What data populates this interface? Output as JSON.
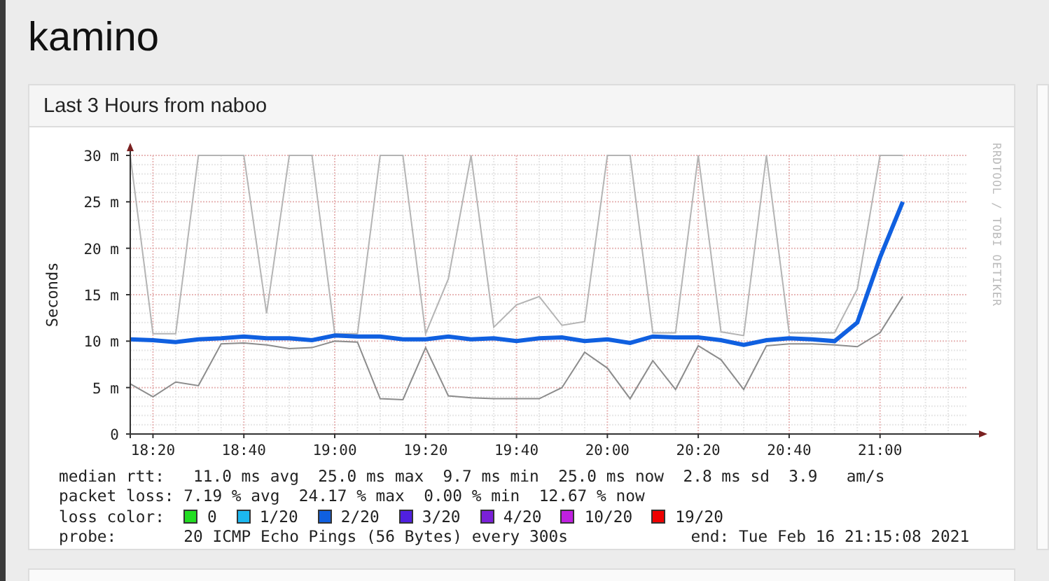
{
  "page_title": "kamino",
  "panel": {
    "title": "Last 3 Hours from naboo",
    "credit": "RRDTOOL / TOBI OETIKER",
    "chart_data": {
      "type": "line",
      "ylabel": "Seconds",
      "categories": [
        null,
        "18:20",
        null,
        null,
        null,
        "18:40",
        null,
        null,
        null,
        "19:00",
        null,
        null,
        null,
        "19:20",
        null,
        null,
        null,
        "19:40",
        null,
        null,
        null,
        "20:00",
        null,
        null,
        null,
        "20:20",
        null,
        null,
        null,
        "20:40",
        null,
        null,
        null,
        "21:00",
        null
      ],
      "ylim": [
        0,
        30
      ],
      "grid": true,
      "yticks": [
        {
          "value": 0,
          "label": "0"
        },
        {
          "value": 5,
          "label": "5 m"
        },
        {
          "value": 10,
          "label": "10 m"
        },
        {
          "value": 15,
          "label": "15 m"
        },
        {
          "value": 20,
          "label": "20 m"
        },
        {
          "value": 25,
          "label": "25 m"
        },
        {
          "value": 30,
          "label": "30 m"
        }
      ],
      "series": [
        {
          "color": "#b4b4b4",
          "values": [
            30,
            10.8,
            10.8,
            30,
            30,
            30,
            13,
            30,
            30,
            10.8,
            10.8,
            30,
            30,
            10.8,
            16.7,
            30,
            11.5,
            13.9,
            14.8,
            11.7,
            12.1,
            30,
            30,
            10.9,
            10.9,
            30,
            11,
            10.6,
            30,
            10.9,
            10.9,
            10.9,
            15.6,
            30,
            30
          ]
        },
        {
          "color": "#8c8c8c",
          "values": [
            5.4,
            4,
            5.6,
            5.2,
            9.7,
            9.8,
            9.6,
            9.2,
            9.3,
            10,
            9.9,
            3.8,
            3.7,
            9.3,
            4.1,
            3.9,
            3.8,
            3.8,
            3.8,
            5,
            8.8,
            7.1,
            3.8,
            7.9,
            4.8,
            9.5,
            8,
            4.8,
            9.5,
            9.7,
            9.7,
            9.6,
            9.4,
            10.9,
            14.8
          ]
        },
        {
          "name": "median rtt:",
          "color": "#1060e0",
          "values": [
            10.2,
            10.1,
            9.9,
            10.2,
            10.3,
            10.5,
            10.3,
            10.3,
            10.1,
            10.6,
            10.5,
            10.5,
            10.2,
            10.2,
            10.5,
            10.2,
            10.3,
            10,
            10.3,
            10.4,
            10,
            10.2,
            9.8,
            10.5,
            10.4,
            10.4,
            10.1,
            9.6,
            10.1,
            10.3,
            10.2,
            10,
            12,
            19,
            25
          ]
        }
      ]
    },
    "stats": [
      {
        "text": " 11.0 ms avg  25.0 ms max  9.7 ms min  25.0 ms now  2.8 ms sd  3.9   am/s"
      },
      {
        "label": "packet loss:",
        "text": "7.19 % avg  24.17 % max  0.00 % min  12.67 % now"
      }
    ],
    "loss_legend": {
      "label": "loss color:",
      "items": [
        {
          "text": "0",
          "color": "#22dd22"
        },
        {
          "text": "1/20",
          "color": "#1cb8f0"
        },
        {
          "text": "2/20",
          "color": "#1060e0"
        },
        {
          "text": "3/20",
          "color": "#5020e0"
        },
        {
          "text": "4/20",
          "color": "#7a20d8"
        },
        {
          "text": "10/20",
          "color": "#c020e0"
        },
        {
          "text": "19/20",
          "color": "#ee0000"
        }
      ]
    },
    "probe": {
      "label": "probe:",
      "text": "20 ICMP Echo Pings (56 Bytes) every 300s",
      "end": "end: Tue Feb 16 21:15:08 2021"
    }
  }
}
